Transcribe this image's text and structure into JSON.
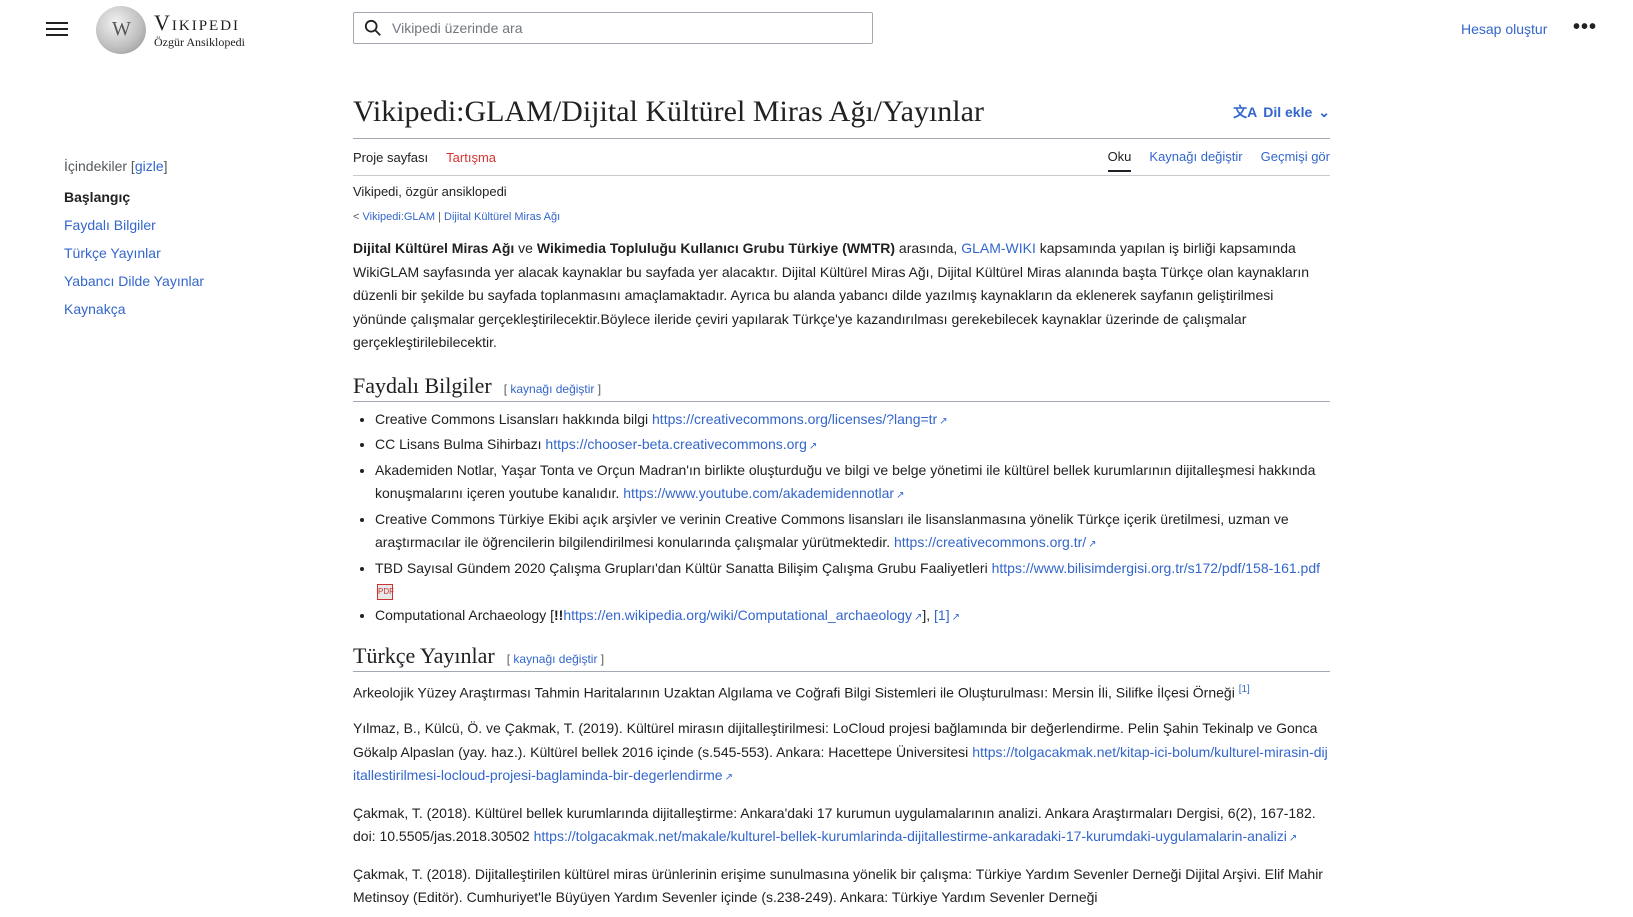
{
  "header": {
    "wordmark": "Vikipedi",
    "tagline": "Özgür Ansiklopedi",
    "search_placeholder": "Vikipedi üzerinde ara",
    "create_account": "Hesap oluştur",
    "more": "•••"
  },
  "toc": {
    "head": "İçindekiler",
    "hide": "gizle",
    "items": [
      "Başlangıç",
      "Faydalı Bilgiler",
      "Türkçe Yayınlar",
      "Yabancı Dilde Yayınlar",
      "Kaynakça"
    ]
  },
  "page": {
    "title": "Vikipedi:GLAM/Dijital Kültürel Miras Ağı/Yayınlar",
    "add_language": "Dil ekle",
    "tabs_left": [
      "Proje sayfası",
      "Tartışma"
    ],
    "tabs_right": [
      "Oku",
      "Kaynağı değiştir",
      "Geçmişi gör"
    ],
    "site_tagline": "Vikipedi, özgür ansiklopedi",
    "breadcrumb_prefix": "<",
    "breadcrumb_1": "Vikipedi:GLAM",
    "breadcrumb_sep": "|",
    "breadcrumb_2": "Dijital Kültürel Miras Ağı"
  },
  "intro": {
    "b1": "Dijital Kültürel Miras Ağı",
    "t1": " ve ",
    "b2": "Wikimedia Topluluğu Kullanıcı Grubu Türkiye (WMTR)",
    "t2": " arasında, ",
    "link": "GLAM-WIKI",
    "t3": " kapsamında yapılan iş birliği kapsamında WikiGLAM sayfasında yer alacak kaynaklar bu sayfada yer alacaktır. Dijital Kültürel Miras Ağı, Dijital Kültürel Miras alanında başta Türkçe olan kaynakların düzenli bir şekilde bu sayfada toplanmasını amaçlamaktadır. Ayrıca bu alanda yabancı dilde yazılmış kaynakların da eklenerek sayfanın geliştirilmesi yönünde çalışmalar gerçekleştirilecektir.Böylece ileride çeviri yapılarak Türkçe'ye kazandırılması gerekebilecek kaynaklar üzerinde de çalışmalar gerçekleştirilebilecektir."
  },
  "sections": {
    "edit_label": "kaynağı değiştir",
    "s1_title": "Faydalı Bilgiler",
    "s2_title": "Türkçe Yayınlar"
  },
  "faydali": [
    {
      "text": "Creative Commons Lisansları hakkında bilgi ",
      "link": "https://creativecommons.org/licenses/?lang=tr"
    },
    {
      "text": "CC Lisans Bulma Sihirbazı ",
      "link": "https://chooser-beta.creativecommons.org"
    },
    {
      "text": "Akademiden Notlar, Yaşar Tonta ve Orçun Madran'ın birlikte oluşturduğu ve bilgi ve belge yönetimi ile kültürel bellek kurumlarının dijitalleşmesi hakkında konuşmalarını içeren youtube kanalıdır. ",
      "link": "https://www.youtube.com/akademidennotlar"
    },
    {
      "text": "Creative Commons Türkiye Ekibi açık arşivler ve verinin Creative Commons lisansları ile lisanslanmasına yönelik Türkçe içerik üretilmesi, uzman ve araştırmacılar ile öğrencilerin bilgilendirilmesi konularında çalışmalar yürütmektedir. ",
      "link": "https://creativecommons.org.tr/"
    },
    {
      "text": "TBD Sayısal Gündem 2020 Çalışma Grupları'dan Kültür Sanatta Bilişim Çalışma Grubu Faaliyetleri ",
      "link": "https://www.bilisimdergisi.org.tr/s172/pdf/158-161.pdf"
    },
    {
      "text": "Computational Archaeology [",
      "bold": "!!",
      "link": "https://en.wikipedia.org/wiki/Computational_archaeology",
      "after": "], ",
      "link2": "[1]"
    }
  ],
  "turkce": [
    {
      "text": "Arkeolojik Yüzey Araştırması Tahmin Haritalarının Uzaktan Algılama ve Coğrafi Bilgi Sistemleri ile Oluşturulması: Mersin İli, Silifke İlçesi Örneği ",
      "sup": "[1]"
    },
    {
      "text": "Yılmaz, B., Külcü, Ö. ve Çakmak, T. (2019). Kültürel mirasın dijitalleştirilmesi: LoCloud projesi bağlamında bir değerlendirme. Pelin Şahin Tekinalp ve Gonca Gökalp Alpaslan (yay. haz.). Kültürel bellek 2016 içinde (s.545-553). Ankara: Hacettepe Üniversitesi ",
      "link": "https://tolgacakmak.net/kitap-ici-bolum/kulturel-mirasin-dijitallestirilmesi-locloud-projesi-baglaminda-bir-degerlendirme"
    },
    {
      "text": "Çakmak, T. (2018). Kültürel bellek kurumlarında dijitalleştirme: Ankara'daki 17 kurumun uygulamalarının analizi. Ankara Araştırmaları Dergisi, 6(2), 167-182. doi: 10.5505/jas.2018.30502 ",
      "link": "https://tolgacakmak.net/makale/kulturel-bellek-kurumlarinda-dijitallestirme-ankaradaki-17-kurumdaki-uygulamalarin-analizi"
    },
    {
      "text": "Çakmak, T. (2018). Dijitalleştirilen kültürel miras ürünlerinin erişime sunulmasına yönelik bir çalışma: Türkiye Yardım Sevenler Derneği Dijital Arşivi. Elif Mahir Metinsoy (Editör). Cumhuriyet'le Büyüyen Yardım Sevenler içinde (s.238-249). Ankara: Türkiye Yardım Sevenler Derneği"
    }
  ],
  "pdf_icon_label": "PDF",
  "colors": {
    "link": "#3366cc",
    "redlink": "#d73333",
    "text": "#202122"
  }
}
